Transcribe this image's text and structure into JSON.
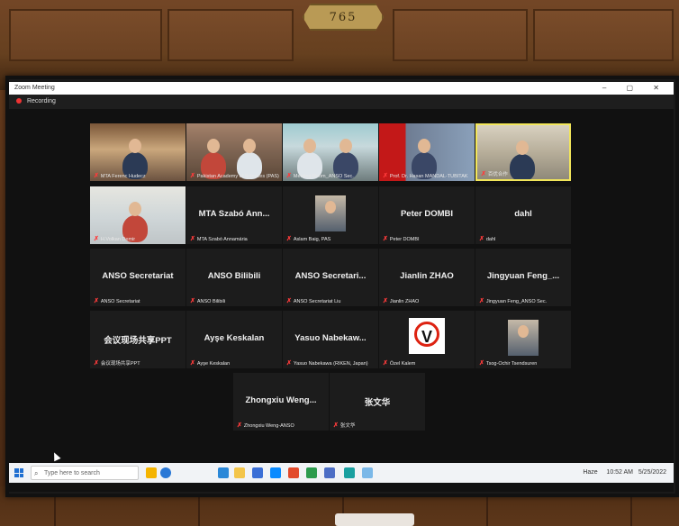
{
  "room": {
    "plaque_number": "765"
  },
  "window": {
    "title": "Zoom Meeting",
    "controls": "– ▢ ✕"
  },
  "recording": {
    "label": "Recording"
  },
  "tiles": [
    {
      "name": "",
      "caption": "MTA Ferenc Hudecz",
      "kind": "video"
    },
    {
      "name": "",
      "caption": "Pakistan Academy of Sciences (PAS)",
      "kind": "video"
    },
    {
      "name": "",
      "caption": "Meeting Room_ANSO Sec.",
      "kind": "video"
    },
    {
      "name": "",
      "caption": "Prof. Dr. Hasan MANDAL-TUBITAK",
      "kind": "video"
    },
    {
      "name": "",
      "caption": "百优合作",
      "kind": "video",
      "active": true
    },
    {
      "name": "",
      "caption": "H.Volkan Demir",
      "kind": "video"
    },
    {
      "name": "MTA Szabó Ann...",
      "caption": "MTA Szabó Annamária",
      "kind": "name"
    },
    {
      "name": "",
      "caption": "Aslam Baig, PAS",
      "kind": "photo"
    },
    {
      "name": "Peter DOMBI",
      "caption": "Peter DOMBI",
      "kind": "name"
    },
    {
      "name": "dahl",
      "caption": "dahl",
      "kind": "name"
    },
    {
      "name": "ANSO Secretariat",
      "caption": "ANSO Secretariat",
      "kind": "name"
    },
    {
      "name": "ANSO Bilibili",
      "caption": "ANSO Bilibili",
      "kind": "name"
    },
    {
      "name": "ANSO Secretari...",
      "caption": "ANSO Secretariat Liu",
      "kind": "name"
    },
    {
      "name": "Jianlin ZHAO",
      "caption": "Jianlin ZHAO",
      "kind": "name"
    },
    {
      "name": "Jingyuan Feng_...",
      "caption": "Jingyuan Feng_ANSO Sec.",
      "kind": "name"
    },
    {
      "name": "会议现场共享PPT",
      "caption": "会议现场共享PPT",
      "kind": "name"
    },
    {
      "name": "Ayşe Keskalan",
      "caption": "Ayşe Keskalan",
      "kind": "name"
    },
    {
      "name": "Yasuo Nabekaw...",
      "caption": "Yasuo Nabekawa (RIKEN, Japan)",
      "kind": "name"
    },
    {
      "name": "",
      "caption": "Özel Kalem",
      "kind": "logo"
    },
    {
      "name": "",
      "caption": "Tsog-Ochir Tsendsuren",
      "kind": "photo"
    },
    {
      "name": "Zhongxiu Weng...",
      "caption": "Zhongxiu Weng-ANSO",
      "kind": "name"
    },
    {
      "name": "张文华",
      "caption": "张文华",
      "kind": "name"
    }
  ],
  "taskbar": {
    "search_placeholder": "Type here to search",
    "weather": "Haze",
    "time": "10:52 AM",
    "date": "5/25/2022"
  },
  "icons": {
    "start": "windows-icon",
    "search": "search-icon",
    "mic": "mic-muted-icon",
    "cursor": "mouse-cursor-icon"
  },
  "colors": {
    "active_speaker": "#f2e65a",
    "muted": "#ff3b3b",
    "tile_bg": "#1c1c1c"
  }
}
